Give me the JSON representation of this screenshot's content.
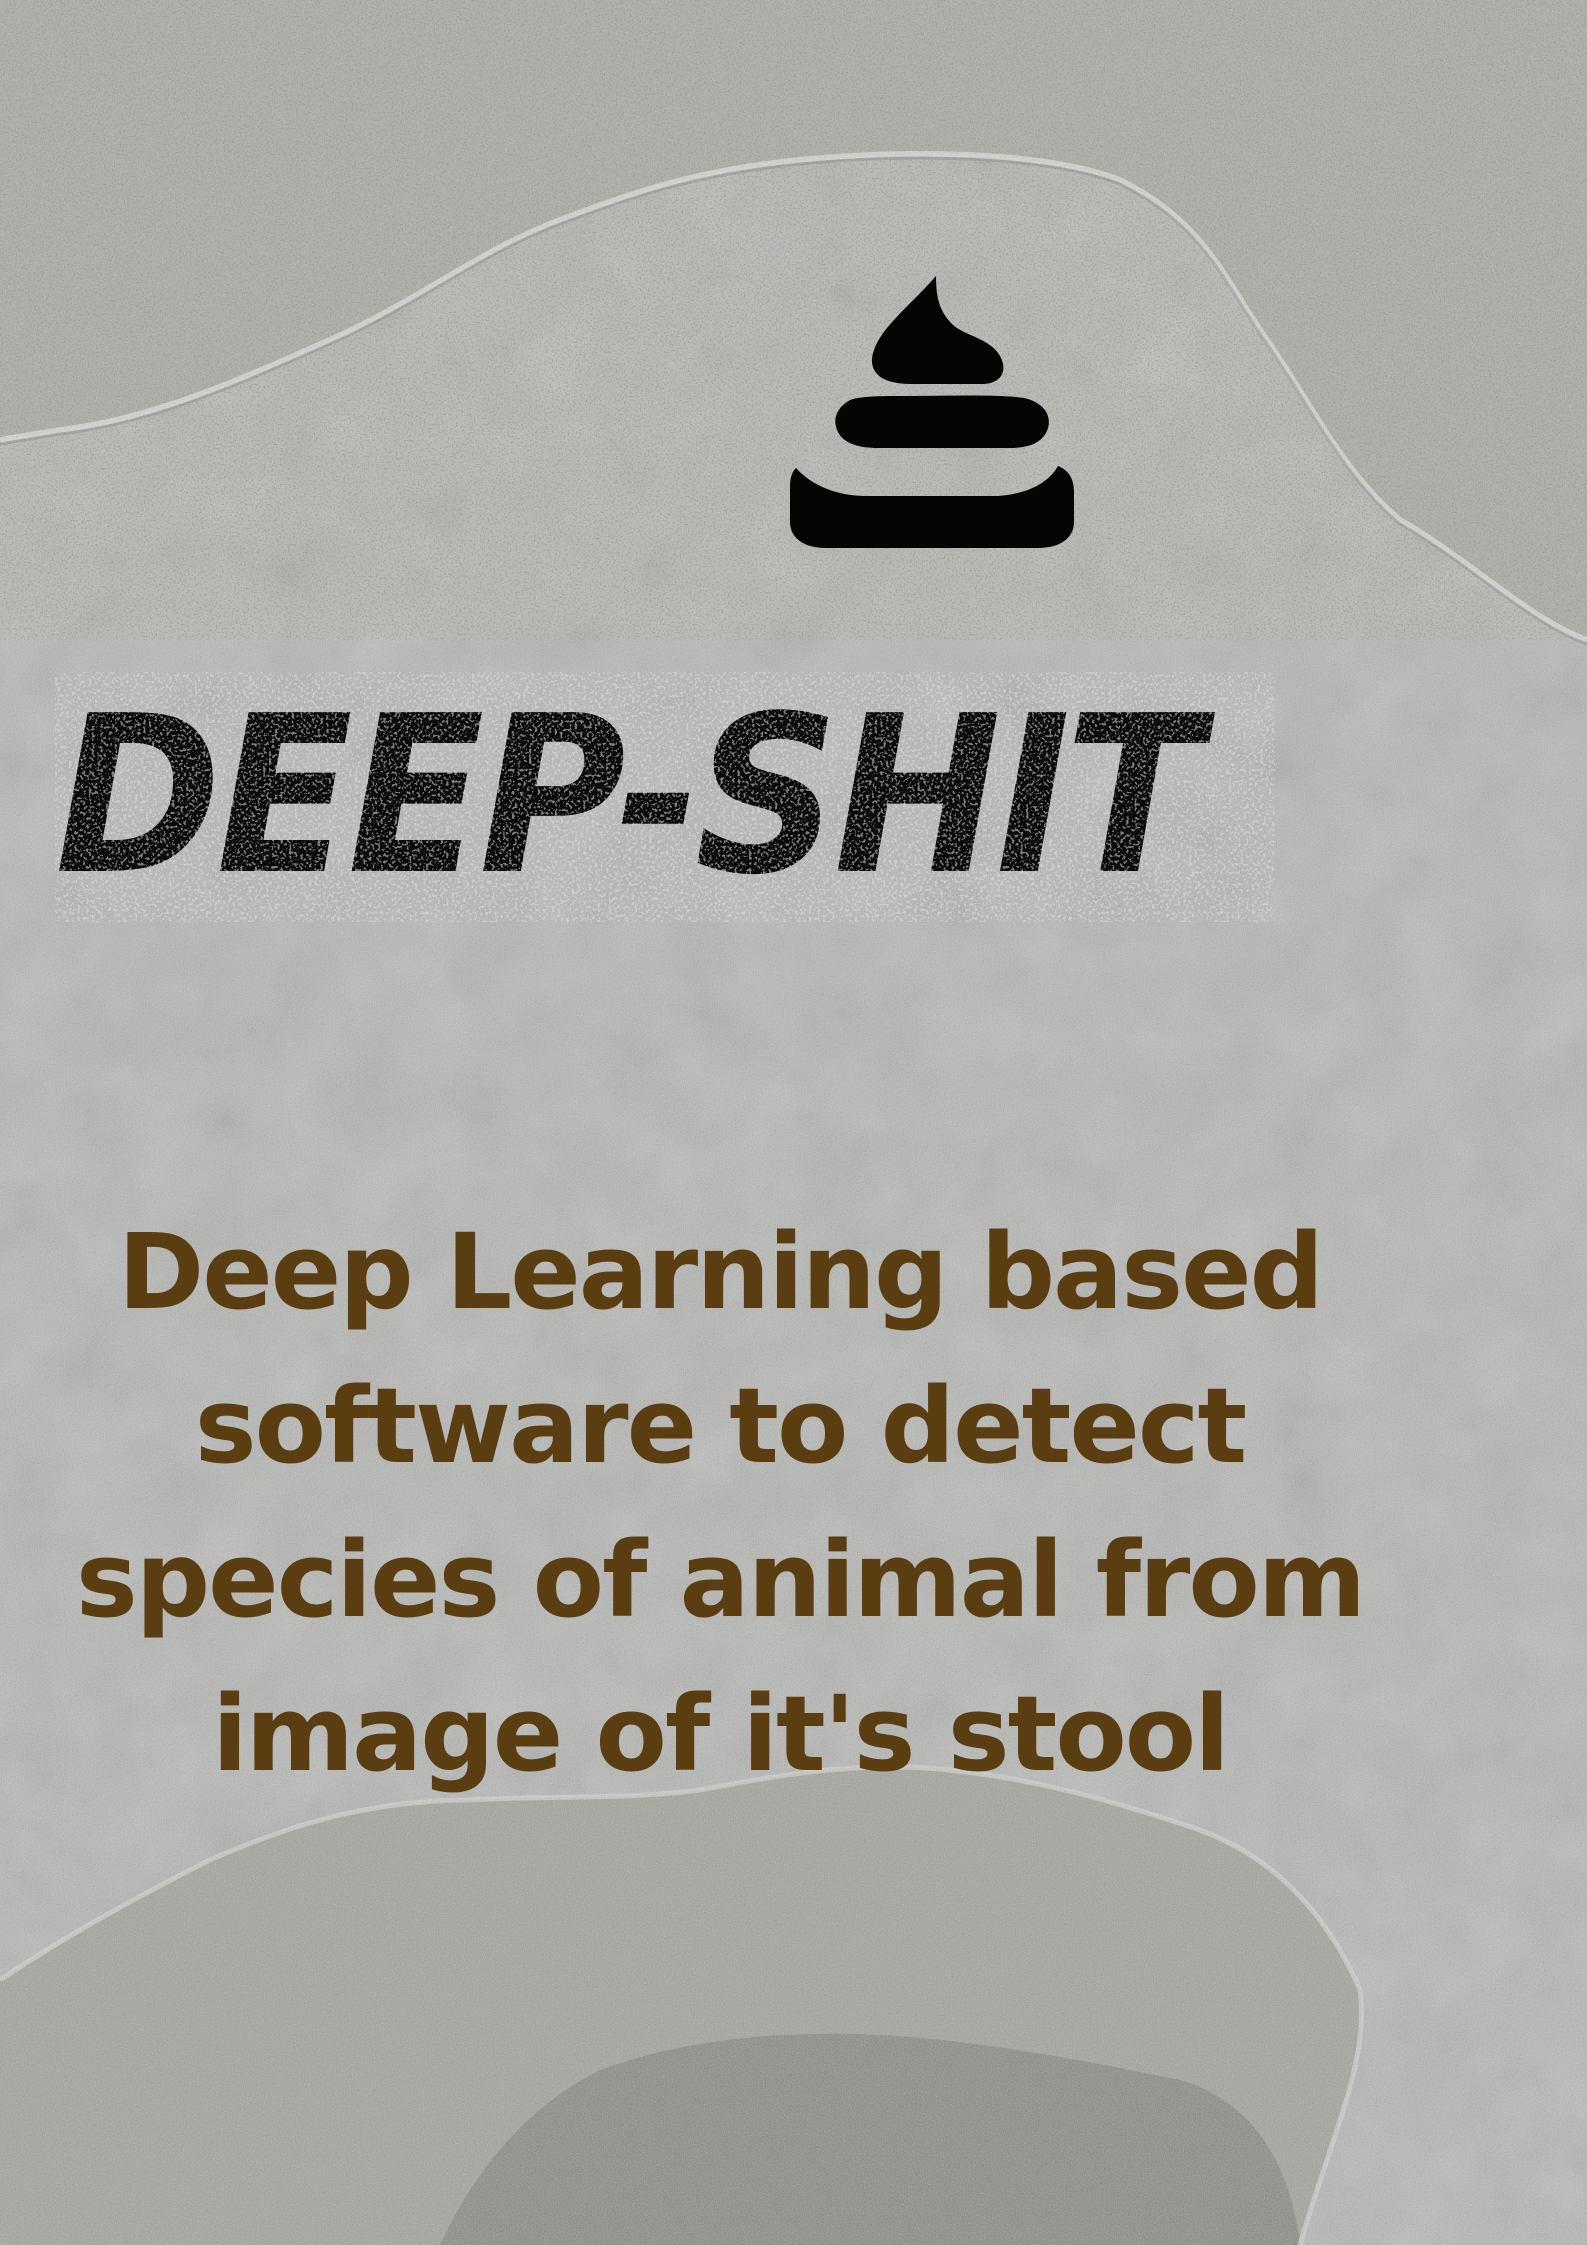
{
  "poster": {
    "logo_icon": "poop-icon",
    "title": "DEEP-SHIT",
    "tagline_lines": [
      "Deep Learning  based",
      "software to detect",
      "species of animal from",
      "image of it's stool"
    ]
  },
  "colors": {
    "wall": "#b4b6b3",
    "title": "#0a0a0a",
    "tagline": "#5a3d10",
    "logo": "#050505"
  }
}
